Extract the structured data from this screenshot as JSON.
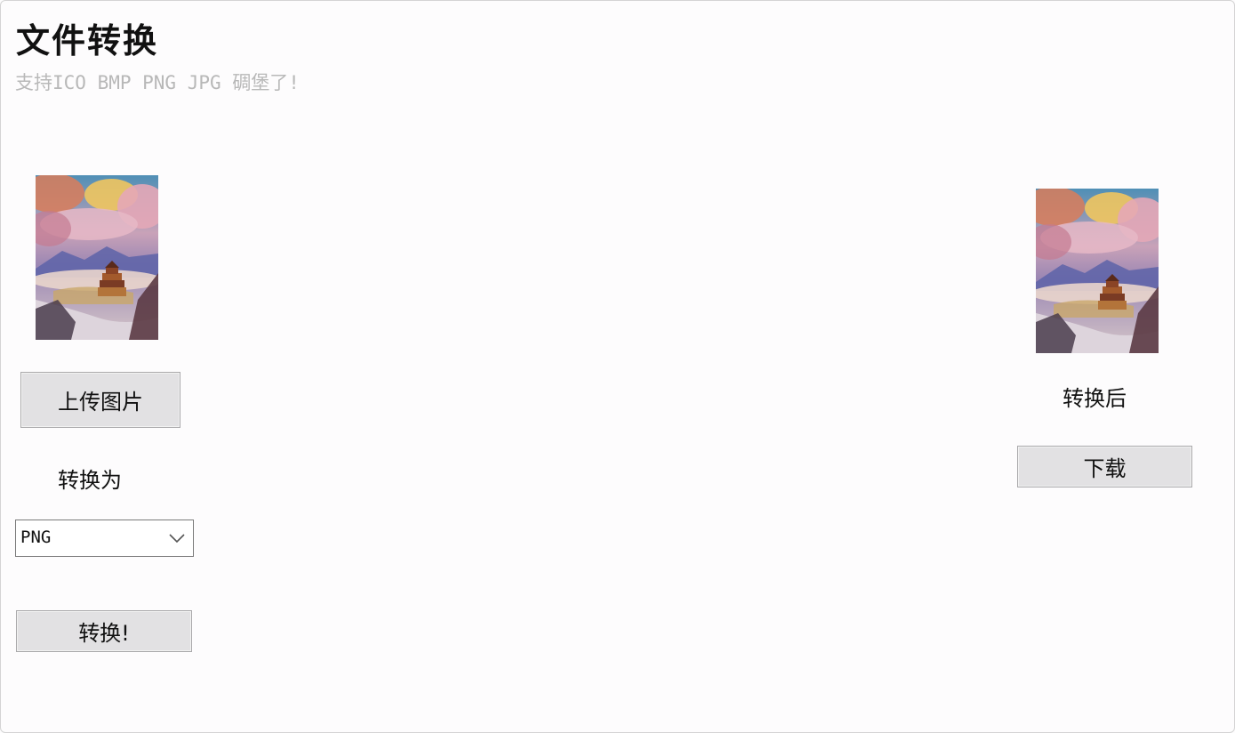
{
  "header": {
    "title": "文件转换",
    "subtitle": "支持ICO BMP PNG JPG 碉堡了!"
  },
  "left_panel": {
    "upload_button": "上传图片",
    "convert_to_label": "转换为",
    "format_select": {
      "selected": "PNG"
    },
    "convert_button": "转换!"
  },
  "right_panel": {
    "after_label": "转换后",
    "download_button": "下载"
  },
  "icons": [
    "chevron-down-icon"
  ],
  "colors": {
    "background": "#fdfcfd",
    "button_bg": "#e2e1e3",
    "subtitle": "#b8b8b8"
  }
}
